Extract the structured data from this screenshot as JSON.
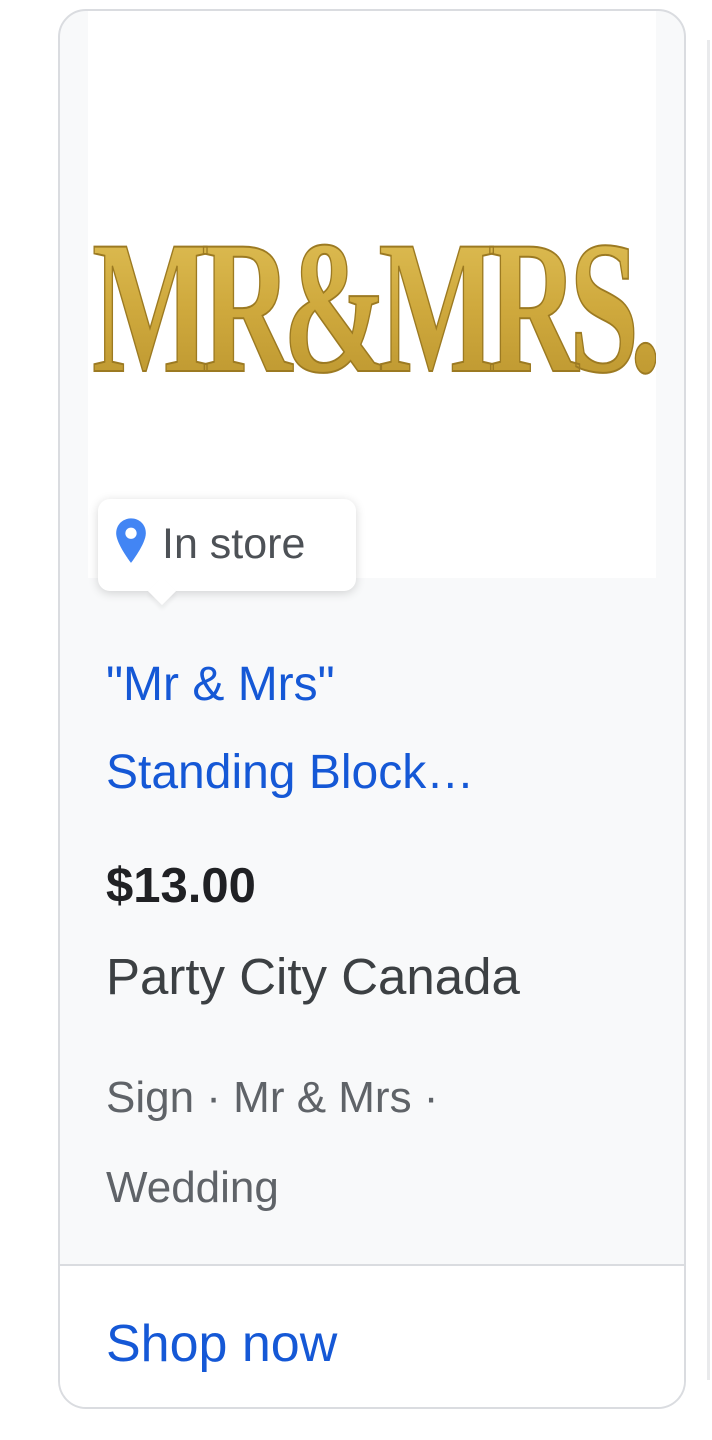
{
  "card": {
    "badge": {
      "icon": "location-pin-icon",
      "label": "In store"
    },
    "product_image": {
      "text": "MR&MRS."
    },
    "title_line1": "\"Mr & Mrs\"",
    "title_line2": "Standing Block…",
    "price": "$13.00",
    "merchant": "Party City Canada",
    "tags_line1": "Sign · Mr & Mrs ·",
    "tags_line2": "Wedding",
    "cta": "Shop now"
  },
  "colors": {
    "link": "#1558d6",
    "gold": "#cfa93d",
    "pin": "#4285f4"
  }
}
